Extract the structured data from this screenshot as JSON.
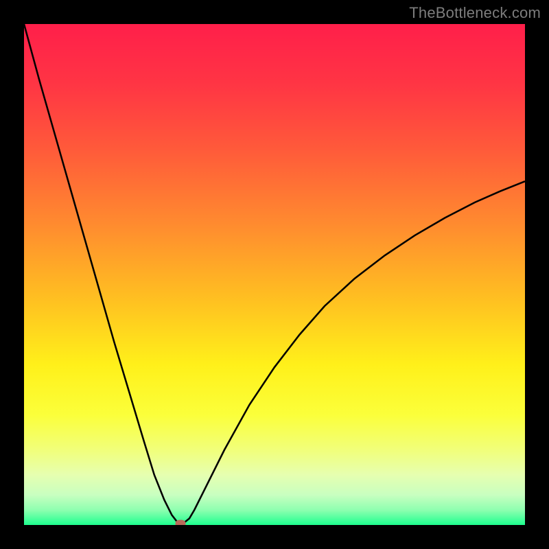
{
  "watermark": "TheBottleneck.com",
  "colors": {
    "black": "#000000",
    "watermark_text": "#7d7d7d",
    "curve_stroke": "#000000",
    "marker_fill": "#b96a5a",
    "gradient_stops": [
      {
        "offset": "0%",
        "color": "#ff1f4a"
      },
      {
        "offset": "12%",
        "color": "#ff3544"
      },
      {
        "offset": "25%",
        "color": "#ff5a3a"
      },
      {
        "offset": "40%",
        "color": "#ff8b2f"
      },
      {
        "offset": "55%",
        "color": "#ffc021"
      },
      {
        "offset": "68%",
        "color": "#fff01a"
      },
      {
        "offset": "78%",
        "color": "#fbff3a"
      },
      {
        "offset": "85%",
        "color": "#f1ff7a"
      },
      {
        "offset": "90%",
        "color": "#e6ffb0"
      },
      {
        "offset": "94%",
        "color": "#c8ffc0"
      },
      {
        "offset": "97%",
        "color": "#8effb0"
      },
      {
        "offset": "100%",
        "color": "#1eff8f"
      }
    ]
  },
  "chart_data": {
    "type": "line",
    "title": "",
    "xlabel": "",
    "ylabel": "",
    "x_range": [
      0,
      100
    ],
    "y_range": [
      0,
      100
    ],
    "x": [
      0,
      3,
      6,
      9,
      12,
      15,
      18,
      21,
      24,
      26,
      28,
      29.5,
      30.5,
      31,
      31.5,
      32,
      33,
      34,
      36,
      40,
      45,
      50,
      55,
      60,
      66,
      72,
      78,
      84,
      90,
      95,
      100
    ],
    "values": [
      100,
      89,
      78.5,
      68,
      57.5,
      47,
      36.5,
      26.5,
      16.5,
      10,
      5,
      2,
      0.7,
      0.3,
      0.3,
      0.5,
      1.3,
      3,
      7,
      15,
      24,
      31.5,
      38,
      43.7,
      49.2,
      53.8,
      57.8,
      61.3,
      64.4,
      66.6,
      68.6
    ],
    "marker": {
      "x": 31.3,
      "y": 0.3
    },
    "note": "x and y are percentage positions inside the colored plot area; y=0 is bottom (green), y=100 is top (red)."
  }
}
